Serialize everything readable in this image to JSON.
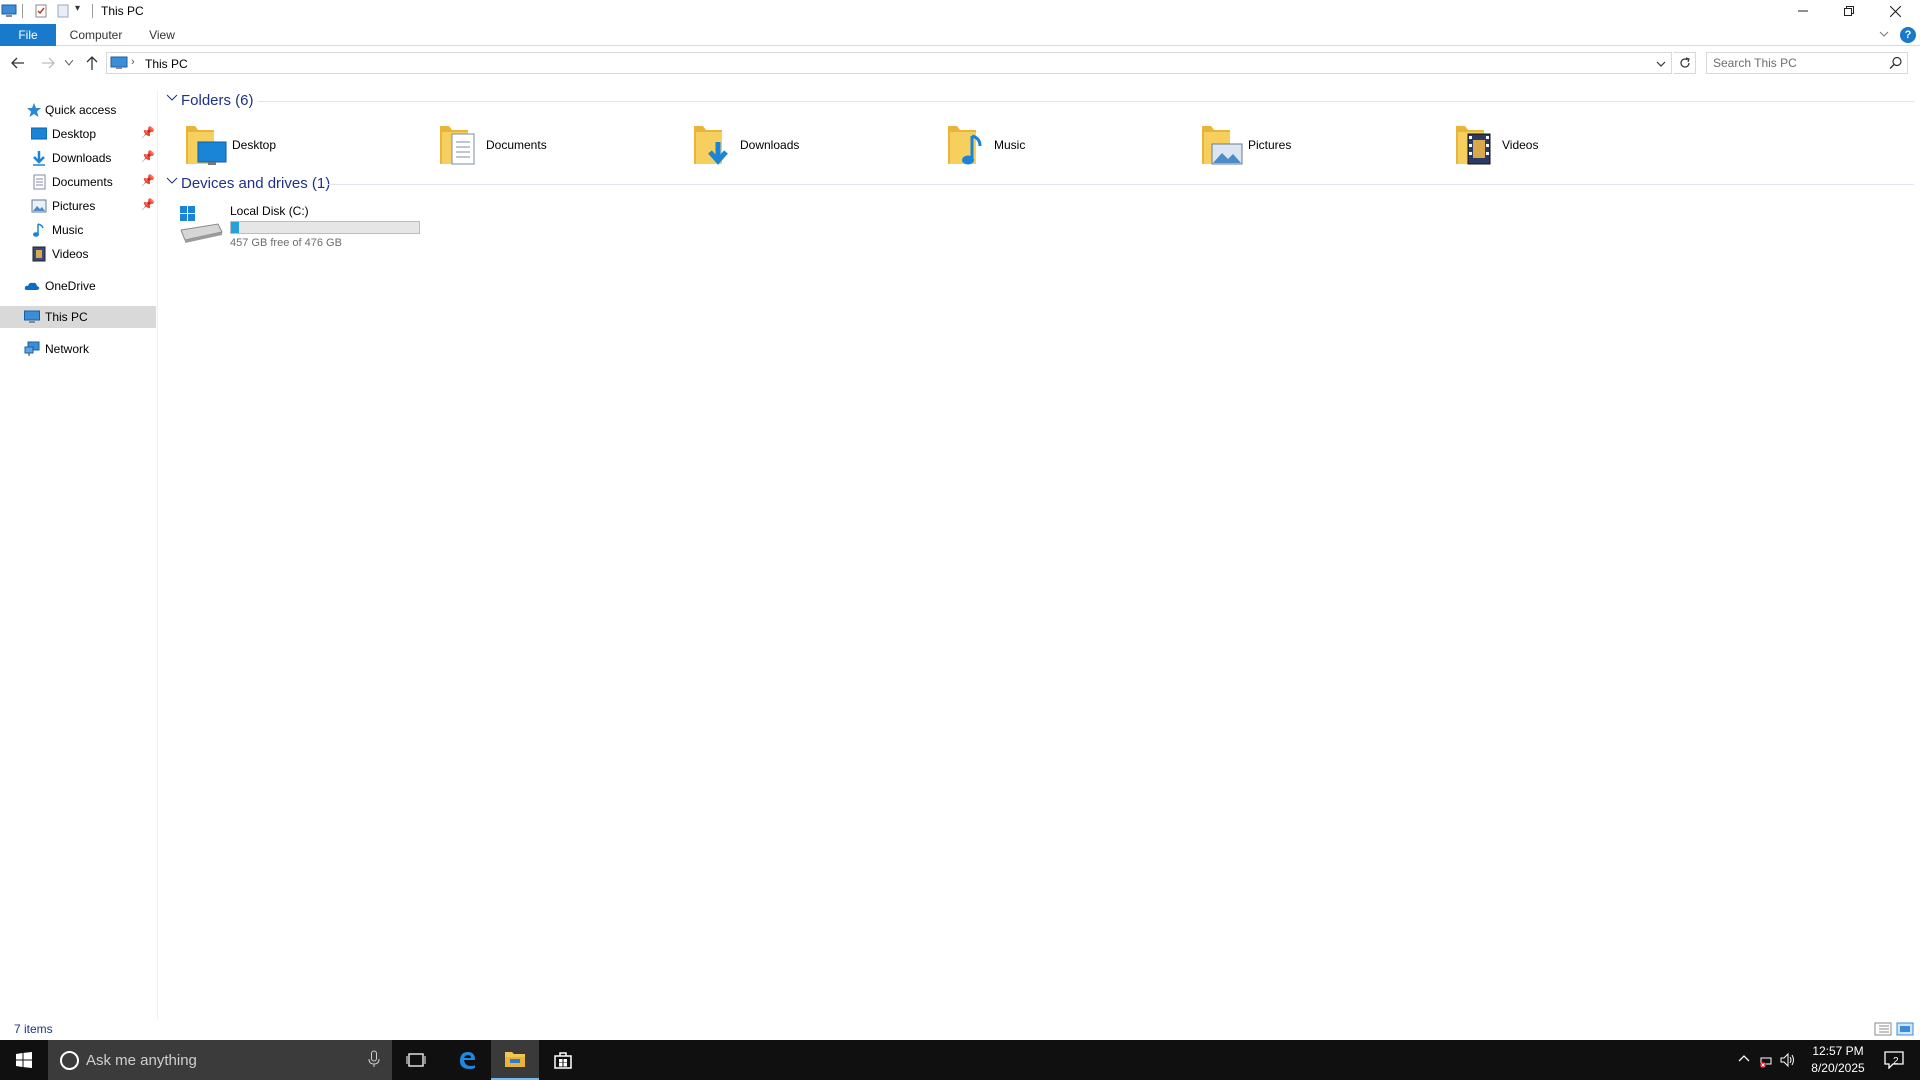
{
  "window": {
    "title": "This PC",
    "ribbon_tabs": [
      "File",
      "Computer",
      "View"
    ]
  },
  "address": {
    "path": "This PC",
    "search_placeholder": "Search This PC"
  },
  "nav_pane": {
    "quick_access": "Quick access",
    "quick_items": [
      {
        "label": "Desktop",
        "pinned": true
      },
      {
        "label": "Downloads",
        "pinned": true
      },
      {
        "label": "Documents",
        "pinned": true
      },
      {
        "label": "Pictures",
        "pinned": true
      },
      {
        "label": "Music",
        "pinned": false
      },
      {
        "label": "Videos",
        "pinned": false
      }
    ],
    "onedrive": "OneDrive",
    "this_pc": "This PC",
    "network": "Network"
  },
  "content": {
    "folders_header": "Folders (6)",
    "folders": [
      "Desktop",
      "Documents",
      "Downloads",
      "Music",
      "Pictures",
      "Videos"
    ],
    "drives_header": "Devices and drives (1)",
    "drive": {
      "name": "Local Disk (C:)",
      "free_text": "457 GB free of 476 GB",
      "used_fraction": 0.04
    }
  },
  "status": {
    "items": "7 items"
  },
  "taskbar": {
    "search_placeholder": "Ask me anything",
    "time": "12:57 PM",
    "date": "8/20/2025",
    "notification_count": "2"
  },
  "colors": {
    "accent": "#1979ca",
    "group_header": "#1e3287",
    "folder": "#f3c74f",
    "taskbar": "#101010"
  }
}
